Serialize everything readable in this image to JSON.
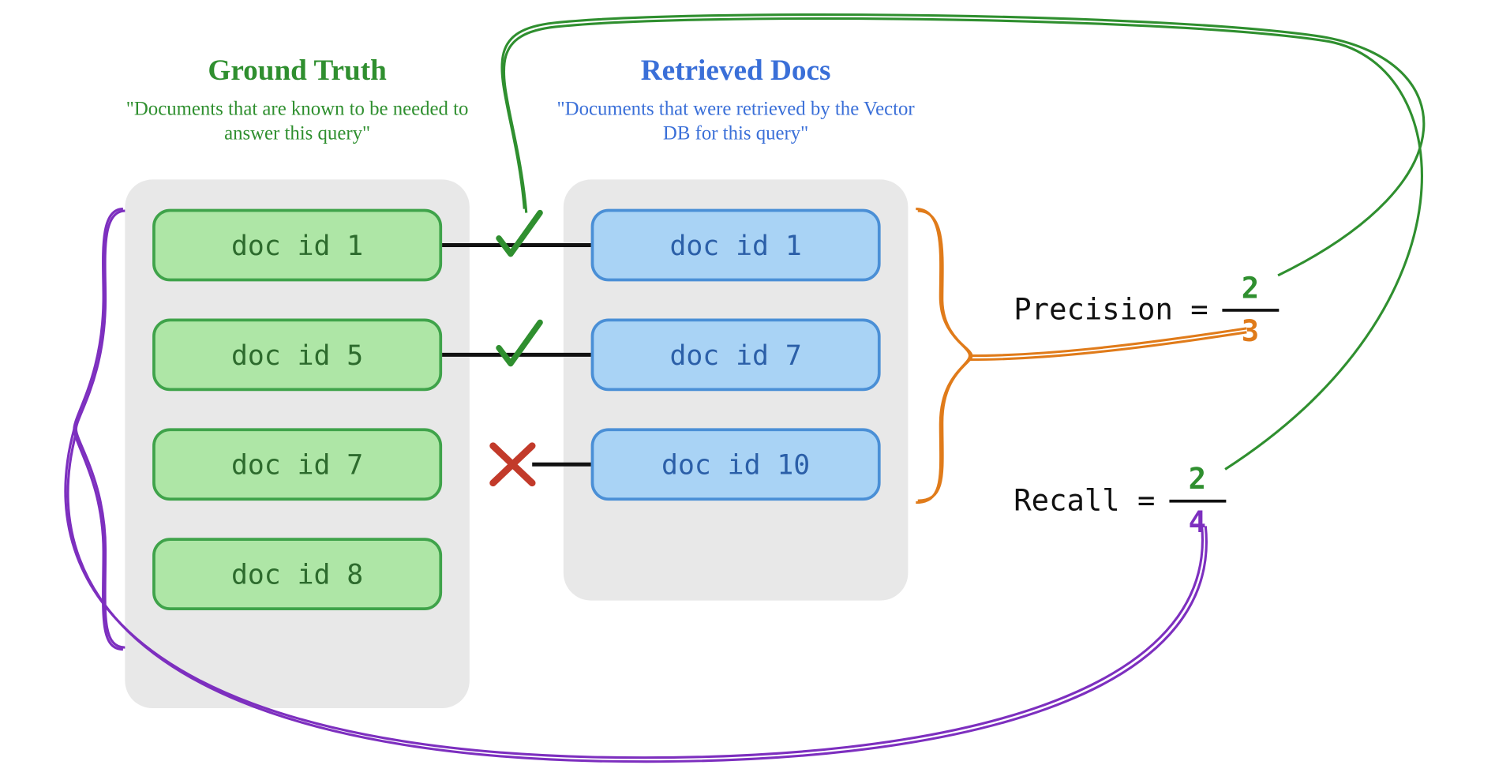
{
  "ground_truth": {
    "title": "Ground Truth",
    "subtitle": "\"Documents that are known to be needed to answer this query\"",
    "docs": [
      "doc id 1",
      "doc id 5",
      "doc id 7",
      "doc id 8"
    ]
  },
  "retrieved": {
    "title": "Retrieved Docs",
    "subtitle": "\"Documents that were retrieved by the Vector DB for this query\"",
    "docs": [
      "doc id 1",
      "doc id 7",
      "doc id 10"
    ]
  },
  "marks": [
    "check",
    "check",
    "cross"
  ],
  "precision": {
    "label": "Precision =",
    "numerator": "2",
    "denominator": "3"
  },
  "recall": {
    "label": "Recall =",
    "numerator": "2",
    "denominator": "4"
  },
  "colors": {
    "green": "#2f8f2f",
    "blue": "#3a6fd8",
    "orange": "#e07b1a",
    "purple": "#7d2fbf",
    "red": "#c23a2a"
  }
}
